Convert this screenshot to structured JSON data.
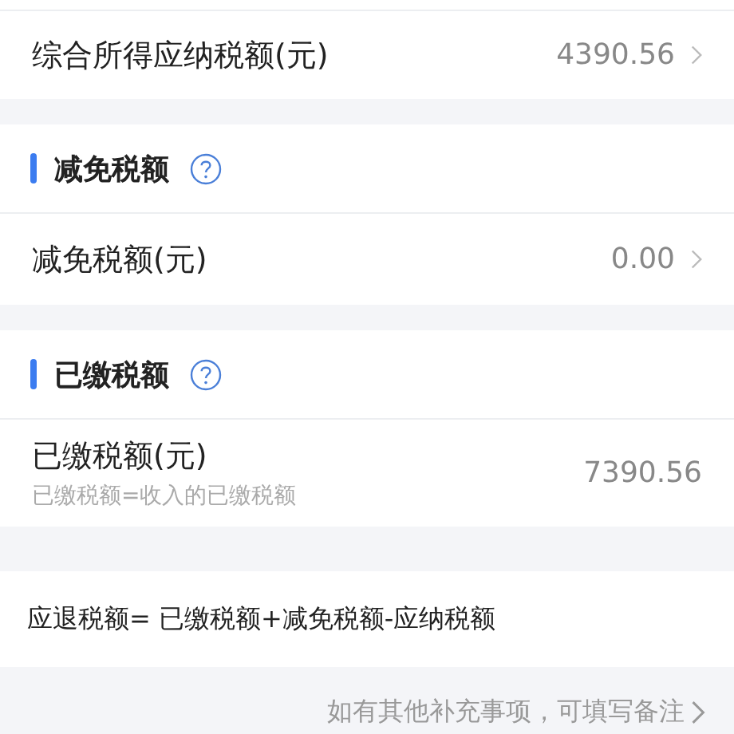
{
  "top_row": {
    "label": "综合所得应纳税额(元)",
    "value": "4390.56",
    "chevron": true
  },
  "sections": [
    {
      "title": "减免税额",
      "help": true,
      "rows": [
        {
          "label": "减免税额(元)",
          "value": "0.00",
          "chevron": true
        }
      ]
    },
    {
      "title": "已缴税额",
      "help": true,
      "rows": [
        {
          "label": "已缴税额(元)",
          "hint": "已缴税额=收入的已缴税额",
          "value": "7390.56",
          "chevron": false
        }
      ]
    }
  ],
  "formula": "应退税额= 已缴税额+减免税额-应纳税额",
  "footer_note": {
    "text": "如有其他补充事项，可填写备注",
    "chevron": true
  }
}
